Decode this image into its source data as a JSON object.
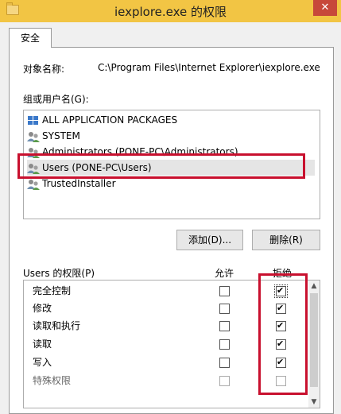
{
  "window": {
    "title": "iexplore.exe 的权限",
    "close_glyph": "✕"
  },
  "tab": {
    "label": "安全"
  },
  "object": {
    "label": "对象名称:",
    "value": "C:\\Program Files\\Internet Explorer\\iexplore.exe"
  },
  "groups": {
    "label": "组或用户名(G):",
    "items": [
      {
        "label": "ALL APPLICATION PACKAGES",
        "icon": "app-packages-icon"
      },
      {
        "label": "SYSTEM",
        "icon": "users-icon"
      },
      {
        "label": "Administrators (PONE-PC\\Administrators)",
        "icon": "users-icon"
      },
      {
        "label": "Users (PONE-PC\\Users)",
        "icon": "users-icon",
        "selected": true
      },
      {
        "label": "TrustedInstaller",
        "icon": "users-icon"
      }
    ]
  },
  "buttons": {
    "add": "添加(D)...",
    "remove": "删除(R)"
  },
  "permissions": {
    "label": "Users 的权限(P)",
    "allow_header": "允许",
    "deny_header": "拒绝",
    "rows": [
      {
        "name": "完全控制",
        "allow": false,
        "deny": true
      },
      {
        "name": "修改",
        "allow": false,
        "deny": true
      },
      {
        "name": "读取和执行",
        "allow": false,
        "deny": true
      },
      {
        "name": "读取",
        "allow": false,
        "deny": true
      },
      {
        "name": "写入",
        "allow": false,
        "deny": true
      },
      {
        "name": "特殊权限",
        "allow": false,
        "deny": false
      }
    ]
  },
  "colors": {
    "titlebar": "#f2c544",
    "highlight_frame": "#c8102e",
    "close_button": "#c7483a"
  }
}
